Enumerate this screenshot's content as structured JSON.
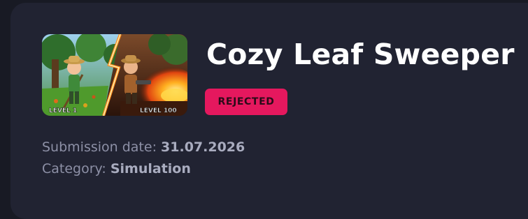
{
  "game": {
    "title": "Cozy Leaf Sweeper",
    "status": "REJECTED",
    "thumbnail": {
      "left_caption": "LEVEL 1",
      "right_caption": "LEVEL 100"
    },
    "submission_label": "Submission date:",
    "submission_date": "31.07.2026",
    "category_label": "Category:",
    "category": "Simulation"
  },
  "colors": {
    "page_bg": "#181a24",
    "card_bg": "#212332",
    "badge_bg": "#e5185e",
    "title": "#ffffff",
    "meta_label": "#8d90a6",
    "meta_value": "#a9acbf"
  }
}
